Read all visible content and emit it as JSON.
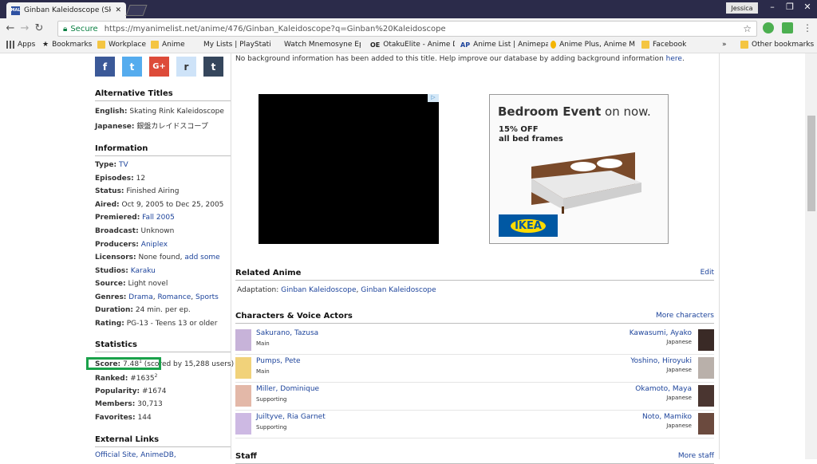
{
  "browser": {
    "tab_title": "Ginban Kaleidoscope (Sk",
    "favicon": "MAL",
    "profile": "Jessica",
    "secure_label": "Secure",
    "url": "https://myanimelist.net/anime/476/Ginban_Kaleidoscope?q=Ginban%20Kaleidoscope",
    "bookmarks": [
      "Apps",
      "Bookmarks",
      "Workplace",
      "Anime",
      "My Lists | PlayStation",
      "Watch Mnemosyne Ep",
      "OtakuElite - Anime D",
      "Anime List | Animepal",
      "Anime Plus, Anime M",
      "Facebook"
    ],
    "overflow": "»",
    "other_bookmarks": "Other bookmarks"
  },
  "social": {
    "facebook": "f",
    "twitter": "t",
    "google": "G+",
    "reddit": "r",
    "tumblr": "t"
  },
  "alt_titles": {
    "heading": "Alternative Titles",
    "english_k": "English:",
    "english_v": "Skating Rink Kaleidoscope",
    "japanese_k": "Japanese:",
    "japanese_v": "銀盤カレイドスコープ"
  },
  "info": {
    "heading": "Information",
    "type_k": "Type:",
    "type_v": "TV",
    "episodes_k": "Episodes:",
    "episodes_v": "12",
    "status_k": "Status:",
    "status_v": "Finished Airing",
    "aired_k": "Aired:",
    "aired_v": "Oct 9, 2005 to Dec 25, 2005",
    "premiered_k": "Premiered:",
    "premiered_v": "Fall 2005",
    "broadcast_k": "Broadcast:",
    "broadcast_v": "Unknown",
    "producers_k": "Producers:",
    "producers_v": "Aniplex",
    "licensors_k": "Licensors:",
    "licensors_v": "None found,",
    "licensors_link": "add some",
    "studios_k": "Studios:",
    "studios_v": "Karaku",
    "source_k": "Source:",
    "source_v": "Light novel",
    "genres_k": "Genres:",
    "genre1": "Drama",
    "genre2": "Romance",
    "genre3": "Sports",
    "duration_k": "Duration:",
    "duration_v": "24 min. per ep.",
    "rating_k": "Rating:",
    "rating_v": "PG-13 - Teens 13 or older"
  },
  "stats": {
    "heading": "Statistics",
    "score_k": "Score:",
    "score_v": "7.48",
    "score_sup": "1",
    "score_rest": "(scored by 15,288 users)",
    "ranked_k": "Ranked:",
    "ranked_v": "#1635",
    "ranked_sup": "2",
    "popularity_k": "Popularity:",
    "popularity_v": "#1674",
    "members_k": "Members:",
    "members_v": "30,713",
    "favorites_k": "Favorites:",
    "favorites_v": "144"
  },
  "external": {
    "heading": "External Links",
    "link1": "Official Site,",
    "link2": "AnimeDB,"
  },
  "main": {
    "background": "No background information has been added to this title. Help improve our database by adding background information",
    "background_link": "here",
    "background_end": ".",
    "ad_chip": "▷",
    "ad_headline": "Bedroom Event",
    "ad_headline2": " on now.",
    "ad_line1": "15% OFF",
    "ad_line2": "all bed frames",
    "ad_brand": "IKEA",
    "related_heading": "Related Anime",
    "related_edit": "Edit",
    "adaptation_k": "Adaptation:",
    "adaptation_v1": "Ginban Kaleidoscope",
    "adaptation_sep": ",",
    "adaptation_v2": "Ginban Kaleidoscope",
    "characters_heading": "Characters & Voice Actors",
    "more_characters": "More characters",
    "staff_heading": "Staff",
    "more_staff": "More staff"
  },
  "characters": [
    {
      "name": "Sakurano, Tazusa",
      "role": "Main",
      "va": "Kawasumi, Ayako",
      "lang": "Japanese"
    },
    {
      "name": "Pumps, Pete",
      "role": "Main",
      "va": "Yoshino, Hiroyuki",
      "lang": "Japanese"
    },
    {
      "name": "Miller, Dominique",
      "role": "Supporting",
      "va": "Okamoto, Maya",
      "lang": "Japanese"
    },
    {
      "name": "Juiltyve, Ria Garnet",
      "role": "Supporting",
      "va": "Noto, Mamiko",
      "lang": "Japanese"
    }
  ],
  "colors": {
    "link": "#1c439b",
    "highlight_box": "#1aa14a",
    "facebook": "#3b5998",
    "twitter": "#55acee",
    "google": "#dd4b39",
    "reddit": "#cee3f8",
    "tumblr": "#35465c"
  }
}
